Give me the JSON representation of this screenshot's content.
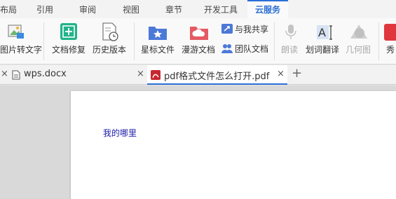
{
  "menu": {
    "tabs": [
      "布局",
      "引用",
      "审阅",
      "视图",
      "章节",
      "开发工具",
      "云服务"
    ],
    "active_tab": "云服务",
    "accent_color": "#2b6fd6"
  },
  "ribbon": {
    "pic_to_text": "图片转文字",
    "doc_repair": "文档修复",
    "history": "历史版本",
    "star_doc": "星标文件",
    "roam_doc": "漫游文档",
    "shared_with_me": "与我共享",
    "team_doc": "团队文档",
    "read_aloud": "朗读",
    "translate": "划词翻译",
    "geometry": "几何图",
    "partial": "秀"
  },
  "document_tabs": {
    "tab1": {
      "title": "wps.docx",
      "icon": "wps-doc-icon"
    },
    "tab2": {
      "title": "pdf格式文件怎么打开.pdf",
      "icon": "pdf-icon"
    },
    "new_tab_symbol": "+",
    "close_symbol": "×"
  },
  "document": {
    "text": "我的哪里"
  }
}
